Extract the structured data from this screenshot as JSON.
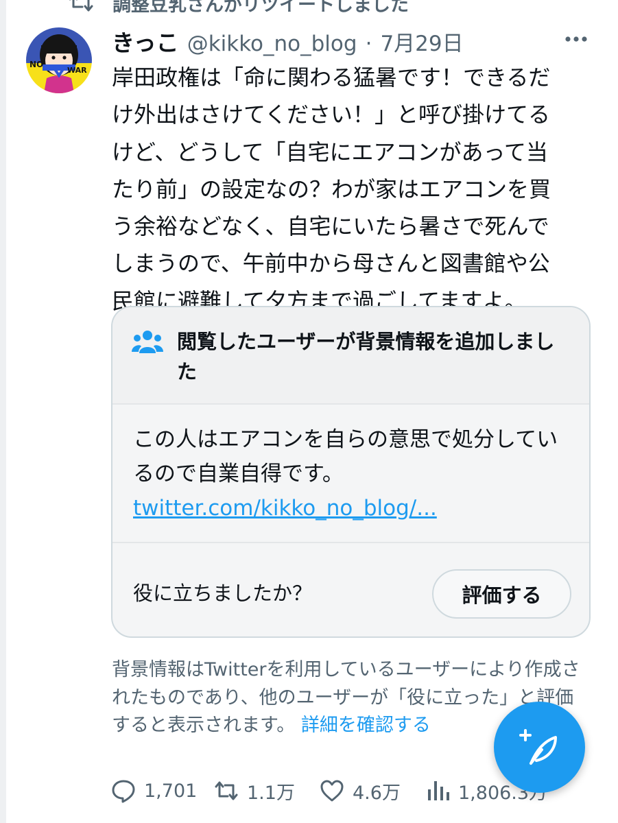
{
  "retweet_banner": {
    "text": "調整豆乳さんがリツイートしました",
    "icon": "retweet-icon"
  },
  "tweet": {
    "avatar": {
      "icon": "avatar",
      "text_left": "NO",
      "text_right": "WAR"
    },
    "display_name": "きっこ",
    "handle": "@kikko_no_blog",
    "separator": "·",
    "date": "7月29日",
    "more_icon": "more-options-icon",
    "text": "岸田政権は「命に関わる猛暑です！できるだ\nけ外出はさけてください！」と呼び掛けてる\nけど、どうして「自宅にエアコンがあって当\nたり前」の設定なの？わが家はエアコンを買\nう余裕などなく、自宅にいたら暑さで死んで\nしまうので、午前中から母さんと図書館や公\n民館に避難して夕方まで過ごしてますよ。"
  },
  "community_note": {
    "icon": "people-icon",
    "title": "閲覧したユーザーが背景情報を追加しました",
    "body": "この人はエアコンを自らの意思で処分しているので自業自得です。",
    "link": "twitter.com/kikko_no_blog/...",
    "question": "役に立ちましたか？",
    "rate_button": "評価する"
  },
  "disclaimer": {
    "text": "背景情報はTwitterを利用しているユーザーにより作成されたものであり、他のユーザーが「役に立った」と評価すると表示されます。",
    "learn_more": "詳細を確認する"
  },
  "actions": {
    "replies": "1,701",
    "retweets": "1.1万",
    "likes": "4.6万",
    "views": "1,806.3万"
  },
  "colors": {
    "accent": "#1d9bf0",
    "secondary_text": "#536471",
    "primary_text": "#0f1419"
  }
}
